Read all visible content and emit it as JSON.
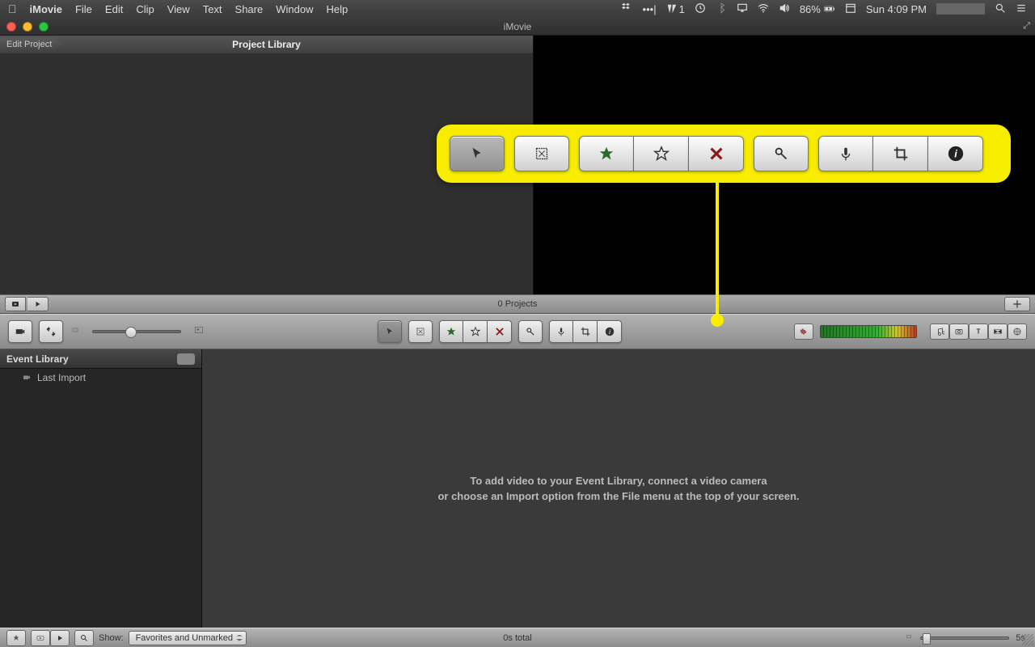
{
  "menubar": {
    "app": "iMovie",
    "items": [
      "File",
      "Edit",
      "Clip",
      "View",
      "Text",
      "Share",
      "Window",
      "Help"
    ],
    "battery": "86%",
    "clock": "Sun 4:09 PM",
    "adobe_badge": "1"
  },
  "window": {
    "title": "iMovie"
  },
  "project": {
    "breadcrumb": "Edit Project",
    "header": "Project Library",
    "count": "0 Projects"
  },
  "event": {
    "header": "Event Library",
    "item": "Last Import",
    "msg_l1": "To add video to your Event Library, connect a video camera",
    "msg_l2": "or choose an Import option from the File menu at the top of your screen."
  },
  "footer": {
    "show_label": "Show:",
    "filter": "Favorites and Unmarked",
    "total": "0s total",
    "slider_label": "5s"
  }
}
